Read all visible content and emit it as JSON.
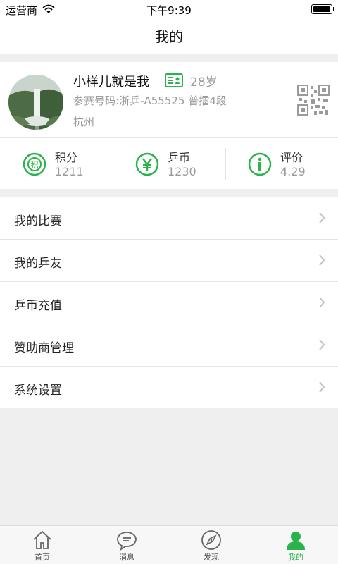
{
  "status_bar": {
    "carrier": "运营商",
    "time": "下午9:39"
  },
  "header": {
    "title": "我的"
  },
  "profile": {
    "name": "小样儿就是我",
    "age": "28岁",
    "registration": "参赛号码:浙乒-A55525 普擂4段",
    "city": "杭州"
  },
  "stats": [
    {
      "label": "积分",
      "value": "1211",
      "icon": "points-icon"
    },
    {
      "label": "乒币",
      "value": "1230",
      "icon": "coin-icon"
    },
    {
      "label": "评价",
      "value": "4.29",
      "icon": "rating-icon"
    }
  ],
  "menu": [
    {
      "label": "我的比赛"
    },
    {
      "label": "我的乒友"
    },
    {
      "label": "乒币充值"
    },
    {
      "label": "赞助商管理"
    },
    {
      "label": "系统设置"
    }
  ],
  "tabbar": [
    {
      "label": "首页",
      "icon": "home-icon"
    },
    {
      "label": "消息",
      "icon": "message-icon"
    },
    {
      "label": "发现",
      "icon": "compass-icon"
    },
    {
      "label": "我的",
      "icon": "user-icon",
      "active": true
    }
  ],
  "colors": {
    "accent": "#2ab34a",
    "background": "#efefef",
    "secondary_text": "#9a9a9a"
  }
}
